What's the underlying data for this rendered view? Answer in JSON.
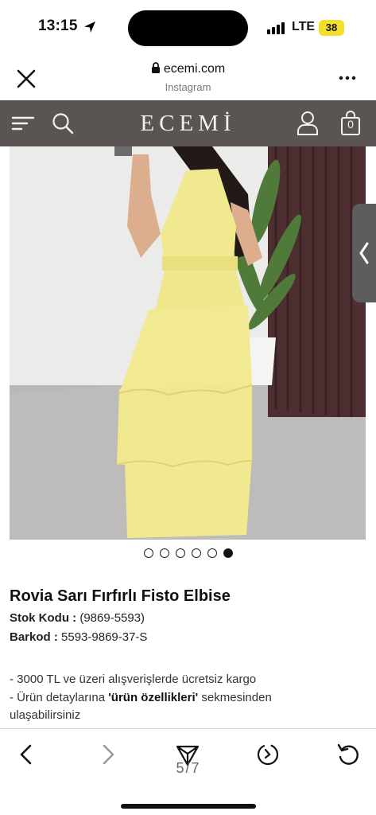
{
  "status_bar": {
    "time": "13:15",
    "network": "LTE",
    "battery": "38"
  },
  "browser": {
    "url": "ecemi.com",
    "source": "Instagram"
  },
  "site": {
    "brand": "ECEMİ",
    "cart_count": "0"
  },
  "gallery": {
    "pages": 6,
    "active_index": 5
  },
  "product": {
    "title": "Rovia Sarı Fırfırlı Fisto Elbise",
    "stock_label": "Stok Kodu :",
    "stock_value": "(9869-5593)",
    "barcode_label": "Barkod :",
    "barcode_value": "5593-9869-37-S",
    "desc_line1": "- 3000 TL ve üzeri alışverişlerde ücretsiz kargo",
    "desc_line2_a": "- Ürün detaylarına ",
    "desc_line2_b": "'ürün özellikleri'",
    "desc_line2_c": " sekmesinden",
    "desc_line3": "ulaşabilirsiniz"
  },
  "toolbar": {
    "page_indicator": "5/7"
  },
  "colors": {
    "nav_bg": "#5a5553",
    "dress": "#f1e98f",
    "battery": "#f3de2c"
  }
}
